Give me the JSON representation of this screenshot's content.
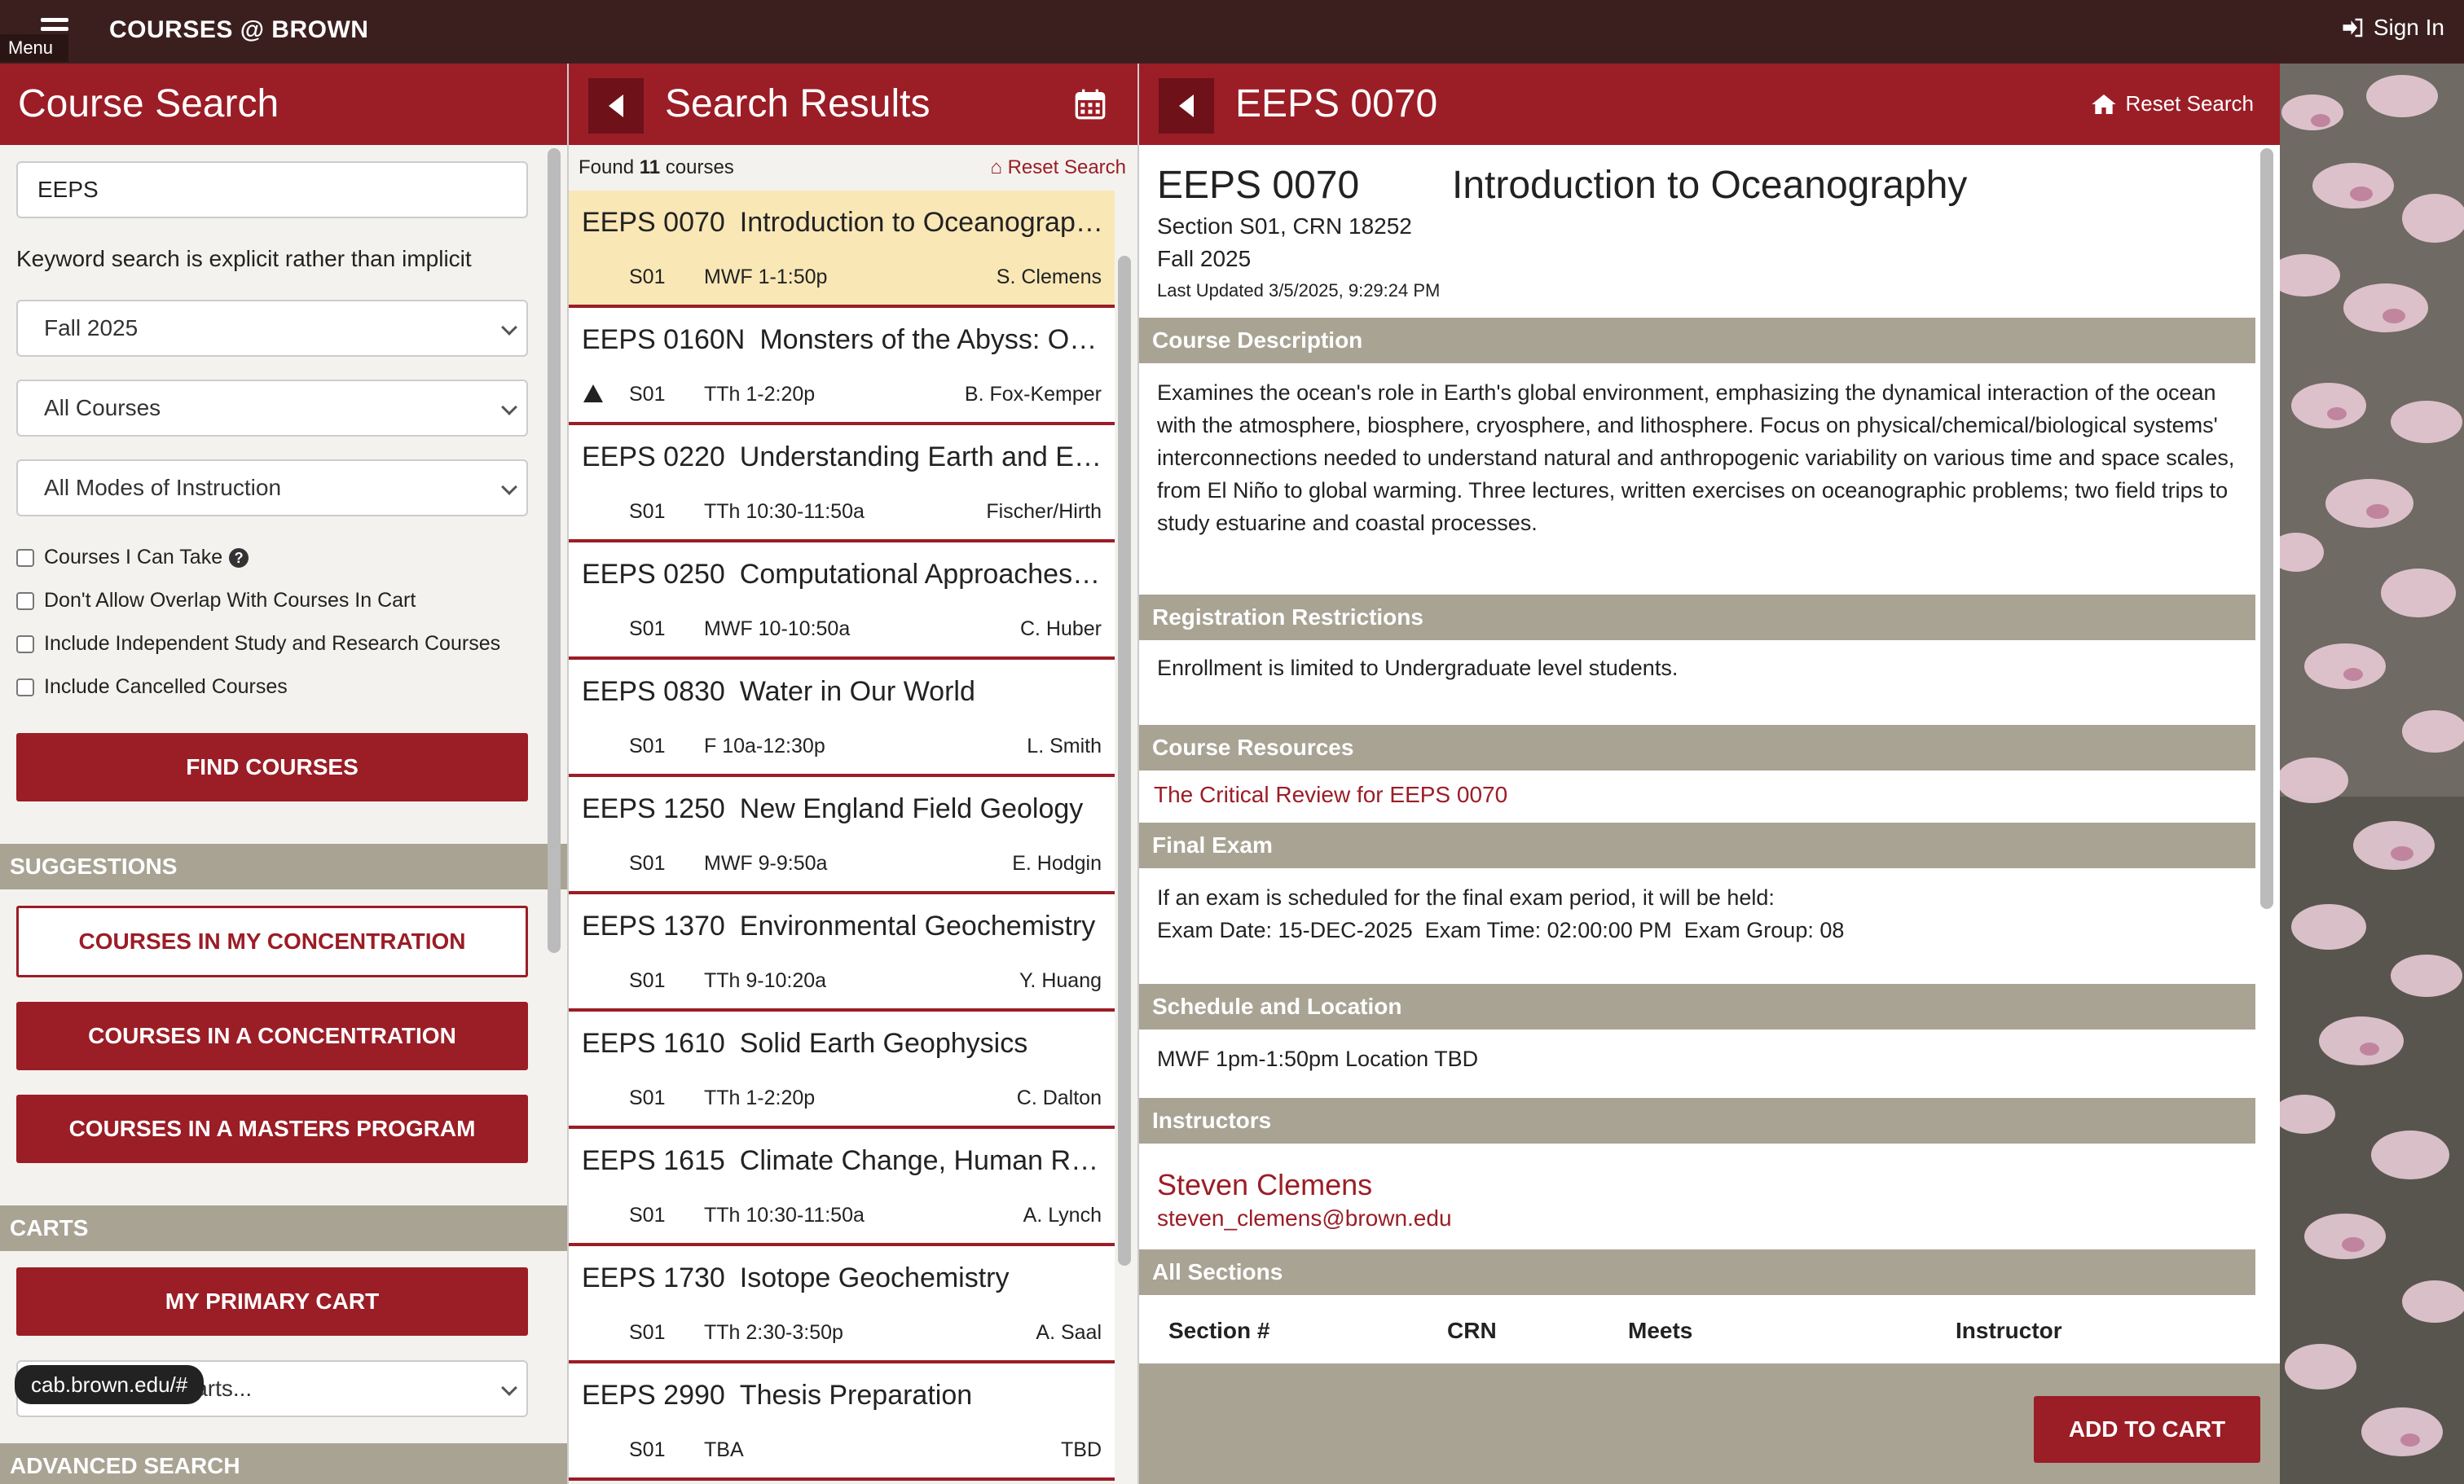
{
  "topbar": {
    "menu_label": "Menu",
    "app_title": "COURSES @ BROWN",
    "signin_label": "Sign In"
  },
  "search_panel": {
    "title": "Course Search",
    "keyword_value": "EEPS",
    "hint": "Keyword search is explicit rather than implicit",
    "term_select": "Fall 2025",
    "courses_select": "All Courses",
    "modes_select": "All Modes of Instruction",
    "checkboxes": [
      {
        "label": "Courses I Can Take",
        "checked": false
      },
      {
        "label": "Don't Allow Overlap With Courses In Cart",
        "checked": false
      },
      {
        "label": "Include Independent Study and Research Courses",
        "checked": false
      },
      {
        "label": "Include Cancelled Courses",
        "checked": false
      }
    ],
    "find_button": "FIND COURSES",
    "suggestions_header": "SUGGESTIONS",
    "suggestion_buttons": [
      "COURSES IN MY CONCENTRATION",
      "COURSES IN A CONCENTRATION",
      "COURSES IN A MASTERS PROGRAM"
    ],
    "carts_header": "CARTS",
    "primary_cart": "MY PRIMARY CART",
    "other_carts": "Other Saved Carts...",
    "advanced_header": "ADVANCED SEARCH",
    "status_url": "cab.brown.edu/#"
  },
  "results_panel": {
    "title": "Search Results",
    "found_prefix": "Found ",
    "found_count": "11",
    "found_suffix": " courses",
    "reset_label": "Reset Search",
    "results": [
      {
        "code": "EEPS 0070",
        "title": "Introduction to Oceanography",
        "section": "S01",
        "time": "MWF 1-1:50p",
        "instructor": "S. Clemens",
        "selected": true,
        "warning": false
      },
      {
        "code": "EEPS 0160N",
        "title": "Monsters of the Abyss: Oce...",
        "section": "S01",
        "time": "TTh 1-2:20p",
        "instructor": "B. Fox-Kemper",
        "selected": false,
        "warning": true
      },
      {
        "code": "EEPS 0220",
        "title": "Understanding Earth and En...",
        "section": "S01",
        "time": "TTh 10:30-11:50a",
        "instructor": "Fischer/Hirth",
        "selected": false,
        "warning": false
      },
      {
        "code": "EEPS 0250",
        "title": "Computational Approaches t...",
        "section": "S01",
        "time": "MWF 10-10:50a",
        "instructor": "C. Huber",
        "selected": false,
        "warning": false
      },
      {
        "code": "EEPS 0830",
        "title": "Water in Our World",
        "section": "S01",
        "time": "F 10a-12:30p",
        "instructor": "L. Smith",
        "selected": false,
        "warning": false
      },
      {
        "code": "EEPS 1250",
        "title": "New England Field Geology",
        "section": "S01",
        "time": "MWF 9-9:50a",
        "instructor": "E. Hodgin",
        "selected": false,
        "warning": false
      },
      {
        "code": "EEPS 1370",
        "title": "Environmental Geochemistry",
        "section": "S01",
        "time": "TTh 9-10:20a",
        "instructor": "Y. Huang",
        "selected": false,
        "warning": false
      },
      {
        "code": "EEPS 1610",
        "title": "Solid Earth Geophysics",
        "section": "S01",
        "time": "TTh 1-2:20p",
        "instructor": "C. Dalton",
        "selected": false,
        "warning": false
      },
      {
        "code": "EEPS 1615",
        "title": "Climate Change, Human Rig...",
        "section": "S01",
        "time": "TTh 10:30-11:50a",
        "instructor": "A. Lynch",
        "selected": false,
        "warning": false
      },
      {
        "code": "EEPS 1730",
        "title": "Isotope Geochemistry",
        "section": "S01",
        "time": "TTh 2:30-3:50p",
        "instructor": "A. Saal",
        "selected": false,
        "warning": false
      },
      {
        "code": "EEPS 2990",
        "title": "Thesis Preparation",
        "section": "S01",
        "time": "TBA",
        "instructor": "TBD",
        "selected": false,
        "warning": false
      }
    ]
  },
  "detail_panel": {
    "header_title": "EEPS 0070",
    "reset_label": "Reset Search",
    "code": "EEPS 0070",
    "title": "Introduction to Oceanography",
    "section_line": "Section S01, CRN 18252",
    "term": "Fall 2025",
    "last_updated": "Last Updated 3/5/2025, 9:29:24 PM",
    "description_header": "Course Description",
    "description": "Examines the ocean's role in Earth's global environment, emphasizing the dynamical interaction of the ocean with the atmosphere, biosphere, cryosphere, and lithosphere. Focus on physical/chemical/biological systems' interconnections needed to understand natural and anthropogenic variability on various time and space scales, from El Niño to global warming. Three lectures, written exercises on oceanographic problems; two field trips to study estuarine and coastal processes.",
    "restrictions_header": "Registration Restrictions",
    "restrictions": "Enrollment is limited to Undergraduate level students.",
    "resources_header": "Course Resources",
    "resources_link": "The Critical Review for EEPS 0070",
    "exam_header": "Final Exam",
    "exam_line1": "If an exam is scheduled for the final exam period, it will be held:",
    "exam_line2": "Exam Date: 15-DEC-2025  Exam Time: 02:00:00 PM  Exam Group: 08",
    "schedule_header": "Schedule and Location",
    "schedule": "MWF 1pm-1:50pm Location TBD",
    "instructors_header": "Instructors",
    "instructor_name": "Steven Clemens",
    "instructor_email": "steven_clemens@brown.edu",
    "sections_header": "All Sections",
    "table_headers": {
      "section": "Section #",
      "crn": "CRN",
      "meets": "Meets",
      "instructor": "Instructor"
    },
    "add_to_cart": "ADD TO CART"
  },
  "colors": {
    "brand": "#9b1d26",
    "topbar": "#3b1f1f",
    "section_bar": "#a9a394",
    "selected_row": "#f9e7b6"
  },
  "icons": {
    "menu": "menu-icon",
    "signin": "sign-in-icon",
    "back": "back-arrow-icon",
    "calendar": "calendar-icon",
    "home": "home-icon",
    "warning": "warning-icon",
    "help": "question-icon"
  }
}
